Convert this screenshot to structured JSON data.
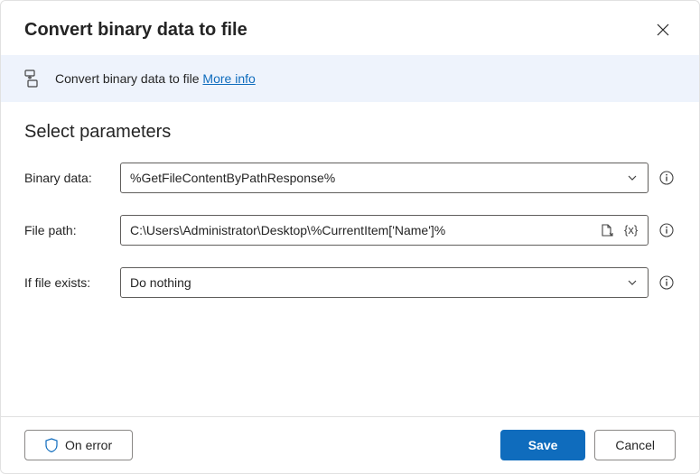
{
  "header": {
    "title": "Convert binary data to file"
  },
  "info": {
    "text": "Convert binary data to file",
    "more_link": "More info"
  },
  "section": {
    "title": "Select parameters"
  },
  "fields": {
    "binary_data": {
      "label": "Binary data:",
      "value": "%GetFileContentByPathResponse%"
    },
    "file_path": {
      "label": "File path:",
      "value": "C:\\Users\\Administrator\\Desktop\\%CurrentItem['Name']%"
    },
    "if_exists": {
      "label": "If file exists:",
      "value": "Do nothing"
    }
  },
  "footer": {
    "on_error": "On error",
    "save": "Save",
    "cancel": "Cancel"
  }
}
